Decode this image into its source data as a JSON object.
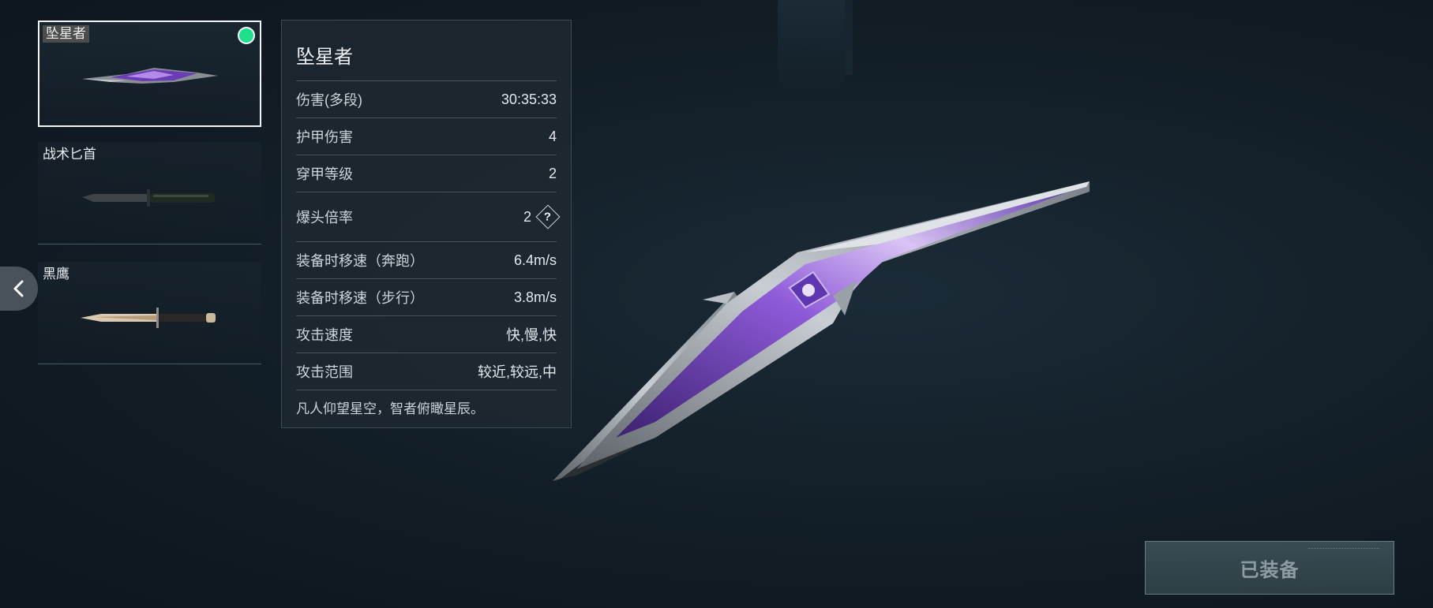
{
  "weapons": [
    {
      "name": "坠星者",
      "selected": true,
      "equipped": true
    },
    {
      "name": "战术匕首",
      "selected": false,
      "equipped": false
    },
    {
      "name": "黑鹰",
      "selected": false,
      "equipped": false
    }
  ],
  "stats_panel": {
    "title": "坠星者",
    "rows": [
      {
        "label": "伤害(多段)",
        "value": "30:35:33"
      },
      {
        "label": "护甲伤害",
        "value": "4"
      },
      {
        "label": "穿甲等级",
        "value": "2"
      },
      {
        "label": "爆头倍率",
        "value": "2"
      },
      {
        "label": "装备时移速（奔跑）",
        "value": "6.4m/s"
      },
      {
        "label": "装备时移速（步行）",
        "value": "3.8m/s"
      },
      {
        "label": "攻击速度",
        "value": "快,慢,快"
      },
      {
        "label": "攻击范围",
        "value": "较近,较远,中"
      }
    ],
    "help_glyph": "?",
    "description": "凡人仰望星空，智者俯瞰星辰。"
  },
  "equip_button": {
    "label": "已装备"
  },
  "icons": {
    "back": "chevron-left-icon",
    "help": "question-diamond-icon",
    "equipped": "equipped-dot-icon"
  },
  "colors": {
    "equipped_dot": "#1ee08a",
    "accent_purple": "#7b3fd0",
    "button_text": "#8d9ca2"
  }
}
